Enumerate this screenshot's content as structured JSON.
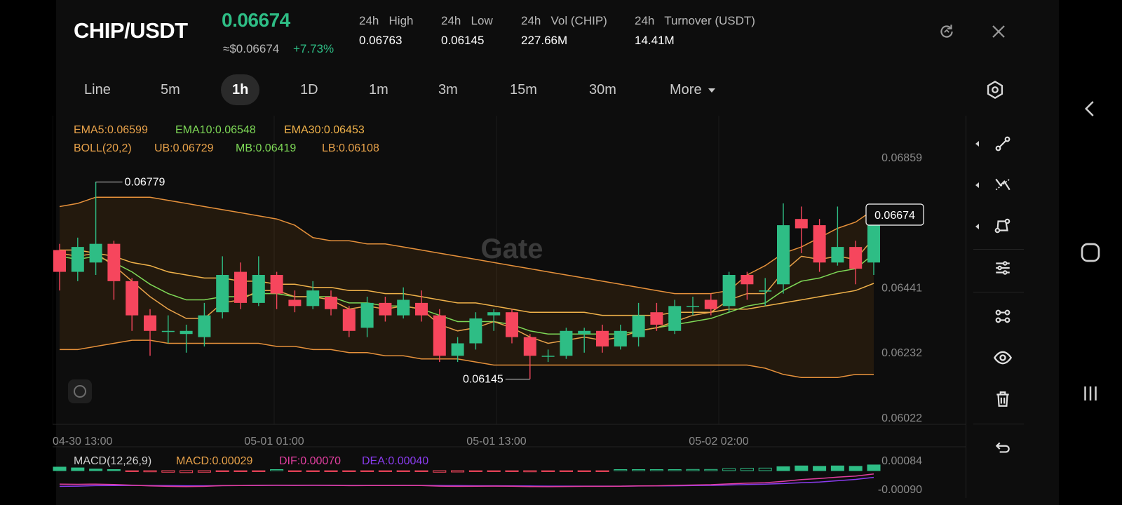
{
  "header": {
    "pair": "CHIP/USDT",
    "price": "0.06674",
    "usd_price": "≈$0.06674",
    "change": "+7.73%",
    "stats": [
      {
        "label": "24h   High",
        "value": "0.06763"
      },
      {
        "label": "24h   Low",
        "value": "0.06145"
      },
      {
        "label": "24h   Vol (CHIP)",
        "value": "227.66M"
      },
      {
        "label": "24h   Turnover (USDT)",
        "value": "14.41M"
      }
    ],
    "icons": [
      "refresh-icon",
      "close-icon"
    ]
  },
  "tabs": [
    {
      "label": "Line"
    },
    {
      "label": "5m"
    },
    {
      "label": "1h",
      "active": true
    },
    {
      "label": "1D"
    },
    {
      "label": "1m"
    },
    {
      "label": "3m"
    },
    {
      "label": "15m"
    },
    {
      "label": "30m"
    },
    {
      "label": "More"
    }
  ],
  "indicators": {
    "ema5": "EMA5:0.06599",
    "ema10": "EMA10:0.06548",
    "ema30": "EMA30:0.06453",
    "boll": "BOLL(20,2)",
    "ub": "UB:0.06729",
    "mb": "MB:0.06419",
    "lb": "LB:0.06108"
  },
  "chart_data": {
    "type": "candlestick",
    "y_axis_ticks": [
      "0.06859",
      "0.06441",
      "0.06232",
      "0.06022"
    ],
    "x_axis_ticks": [
      "04-30 13:00",
      "05-01 01:00",
      "05-01 13:00",
      "05-02 02:00"
    ],
    "high_marker": "0.06779",
    "low_marker": "0.06145",
    "last_price_label": "0.06674",
    "watermark": "Gate",
    "candles": [
      {
        "o": 0.0656,
        "c": 0.0649,
        "h": 0.0658,
        "l": 0.0643
      },
      {
        "o": 0.0649,
        "c": 0.0657,
        "h": 0.066,
        "l": 0.0646
      },
      {
        "o": 0.0652,
        "c": 0.0658,
        "h": 0.0678,
        "l": 0.0648
      },
      {
        "o": 0.0658,
        "c": 0.0646,
        "h": 0.0659,
        "l": 0.064
      },
      {
        "o": 0.0646,
        "c": 0.0635,
        "h": 0.0647,
        "l": 0.063
      },
      {
        "o": 0.0635,
        "c": 0.063,
        "h": 0.0637,
        "l": 0.0622
      },
      {
        "o": 0.063,
        "c": 0.063,
        "h": 0.0635,
        "l": 0.0626
      },
      {
        "o": 0.0629,
        "c": 0.063,
        "h": 0.0632,
        "l": 0.0623
      },
      {
        "o": 0.0628,
        "c": 0.0635,
        "h": 0.0639,
        "l": 0.0625
      },
      {
        "o": 0.0636,
        "c": 0.0648,
        "h": 0.0654,
        "l": 0.0634
      },
      {
        "o": 0.0649,
        "c": 0.0639,
        "h": 0.0652,
        "l": 0.0637
      },
      {
        "o": 0.0639,
        "c": 0.0648,
        "h": 0.0654,
        "l": 0.0638
      },
      {
        "o": 0.0648,
        "c": 0.0642,
        "h": 0.0649,
        "l": 0.0637
      },
      {
        "o": 0.064,
        "c": 0.0638,
        "h": 0.0643,
        "l": 0.0636
      },
      {
        "o": 0.0638,
        "c": 0.0643,
        "h": 0.0646,
        "l": 0.0637
      },
      {
        "o": 0.0641,
        "c": 0.0637,
        "h": 0.0643,
        "l": 0.0635
      },
      {
        "o": 0.0637,
        "c": 0.063,
        "h": 0.0638,
        "l": 0.0628
      },
      {
        "o": 0.0631,
        "c": 0.0639,
        "h": 0.0641,
        "l": 0.0628
      },
      {
        "o": 0.0639,
        "c": 0.0635,
        "h": 0.0641,
        "l": 0.0633
      },
      {
        "o": 0.0635,
        "c": 0.064,
        "h": 0.0644,
        "l": 0.0634
      },
      {
        "o": 0.0639,
        "c": 0.0635,
        "h": 0.0643,
        "l": 0.0633
      },
      {
        "o": 0.0635,
        "c": 0.0622,
        "h": 0.0637,
        "l": 0.062
      },
      {
        "o": 0.0622,
        "c": 0.0626,
        "h": 0.0628,
        "l": 0.062
      },
      {
        "o": 0.0626,
        "c": 0.0634,
        "h": 0.0636,
        "l": 0.0624
      },
      {
        "o": 0.0635,
        "c": 0.0636,
        "h": 0.0637,
        "l": 0.063
      },
      {
        "o": 0.0636,
        "c": 0.0628,
        "h": 0.0637,
        "l": 0.0626
      },
      {
        "o": 0.0628,
        "c": 0.0622,
        "h": 0.0629,
        "l": 0.06145
      },
      {
        "o": 0.0622,
        "c": 0.0622,
        "h": 0.0624,
        "l": 0.062
      },
      {
        "o": 0.0622,
        "c": 0.063,
        "h": 0.0631,
        "l": 0.0621
      },
      {
        "o": 0.0629,
        "c": 0.063,
        "h": 0.0631,
        "l": 0.0623
      },
      {
        "o": 0.063,
        "c": 0.0625,
        "h": 0.0632,
        "l": 0.0623
      },
      {
        "o": 0.0625,
        "c": 0.063,
        "h": 0.0632,
        "l": 0.0624
      },
      {
        "o": 0.0628,
        "c": 0.0635,
        "h": 0.0639,
        "l": 0.0625
      },
      {
        "o": 0.0636,
        "c": 0.0632,
        "h": 0.0639,
        "l": 0.063
      },
      {
        "o": 0.063,
        "c": 0.0638,
        "h": 0.064,
        "l": 0.0629
      },
      {
        "o": 0.0638,
        "c": 0.0638,
        "h": 0.0641,
        "l": 0.0635
      },
      {
        "o": 0.064,
        "c": 0.0637,
        "h": 0.0642,
        "l": 0.0635
      },
      {
        "o": 0.0638,
        "c": 0.0648,
        "h": 0.0649,
        "l": 0.0636
      },
      {
        "o": 0.0648,
        "c": 0.0645,
        "h": 0.0649,
        "l": 0.064
      },
      {
        "o": 0.0643,
        "c": 0.0643,
        "h": 0.0647,
        "l": 0.0638
      },
      {
        "o": 0.0645,
        "c": 0.0664,
        "h": 0.0671,
        "l": 0.0642
      },
      {
        "o": 0.0666,
        "c": 0.0663,
        "h": 0.067,
        "l": 0.0655
      },
      {
        "o": 0.0664,
        "c": 0.0652,
        "h": 0.0666,
        "l": 0.0649
      },
      {
        "o": 0.0652,
        "c": 0.0657,
        "h": 0.067,
        "l": 0.0651
      },
      {
        "o": 0.0657,
        "c": 0.065,
        "h": 0.0659,
        "l": 0.0645
      },
      {
        "o": 0.0652,
        "c": 0.06674,
        "h": 0.06674,
        "l": 0.0648
      }
    ],
    "boll_upper": [
      0.067,
      0.0671,
      0.0673,
      0.0673,
      0.0673,
      0.0673,
      0.0672,
      0.0671,
      0.067,
      0.0669,
      0.0668,
      0.0667,
      0.0666,
      0.0664,
      0.066,
      0.0659,
      0.0659,
      0.0658,
      0.0658,
      0.0657,
      0.0656,
      0.0655,
      0.0654,
      0.0653,
      0.0652,
      0.0651,
      0.065,
      0.0649,
      0.0648,
      0.0647,
      0.0646,
      0.0645,
      0.0644,
      0.0643,
      0.0642,
      0.0642,
      0.0642,
      0.0643,
      0.0648,
      0.0651,
      0.0655,
      0.0657,
      0.066,
      0.0663,
      0.0665,
      0.0669
    ],
    "boll_lower": [
      0.0624,
      0.0624,
      0.0625,
      0.0626,
      0.0627,
      0.0627,
      0.0626,
      0.0626,
      0.0626,
      0.0626,
      0.0626,
      0.0626,
      0.0625,
      0.0625,
      0.0624,
      0.0624,
      0.0623,
      0.0623,
      0.0622,
      0.0622,
      0.0621,
      0.0621,
      0.0621,
      0.062,
      0.0619,
      0.0619,
      0.0619,
      0.0619,
      0.0619,
      0.0619,
      0.0619,
      0.0619,
      0.0619,
      0.0619,
      0.0619,
      0.0619,
      0.0619,
      0.0619,
      0.0619,
      0.0618,
      0.0616,
      0.0615,
      0.0615,
      0.0615,
      0.0616,
      0.0616
    ],
    "ema30": [
      0.0656,
      0.0656,
      0.0655,
      0.0654,
      0.0652,
      0.0651,
      0.0649,
      0.0648,
      0.0647,
      0.0647,
      0.0646,
      0.0646,
      0.0645,
      0.0645,
      0.0644,
      0.0644,
      0.0643,
      0.0643,
      0.0642,
      0.0642,
      0.0641,
      0.064,
      0.0639,
      0.0639,
      0.0638,
      0.0637,
      0.0636,
      0.0636,
      0.0636,
      0.0636,
      0.0635,
      0.0635,
      0.0635,
      0.0635,
      0.0636,
      0.0636,
      0.0636,
      0.0637,
      0.0637,
      0.0638,
      0.0639,
      0.064,
      0.0641,
      0.0642,
      0.0643,
      0.06453
    ],
    "ema10": [
      0.0654,
      0.0653,
      0.0654,
      0.0652,
      0.0649,
      0.0645,
      0.0642,
      0.064,
      0.064,
      0.0641,
      0.0641,
      0.0642,
      0.0642,
      0.0641,
      0.0641,
      0.0641,
      0.0639,
      0.0639,
      0.0638,
      0.0638,
      0.0637,
      0.0635,
      0.0633,
      0.0633,
      0.0633,
      0.0632,
      0.063,
      0.0629,
      0.0629,
      0.0629,
      0.0629,
      0.0629,
      0.063,
      0.0631,
      0.0632,
      0.0633,
      0.0634,
      0.0636,
      0.0638,
      0.0639,
      0.0643,
      0.0646,
      0.0647,
      0.0649,
      0.065,
      0.06548
    ],
    "ema5": [
      0.0655,
      0.0654,
      0.0655,
      0.0651,
      0.0646,
      0.0641,
      0.0637,
      0.0634,
      0.0634,
      0.0639,
      0.064,
      0.0643,
      0.0643,
      0.0641,
      0.0641,
      0.064,
      0.0637,
      0.0638,
      0.0637,
      0.0638,
      0.0637,
      0.0632,
      0.063,
      0.0631,
      0.0633,
      0.0631,
      0.0628,
      0.0626,
      0.0627,
      0.0628,
      0.0627,
      0.0628,
      0.063,
      0.0631,
      0.0633,
      0.0635,
      0.0636,
      0.064,
      0.0642,
      0.0642,
      0.0649,
      0.0654,
      0.0653,
      0.0654,
      0.0653,
      0.06599
    ]
  },
  "macd": {
    "label": "MACD(12,26,9)",
    "macd": "MACD:0.00029",
    "dif": "DIF:0.00070",
    "dea": "DEA:0.00040",
    "ticks": [
      "0.00084",
      "-0.00090"
    ],
    "histogram": [
      0.00018,
      0.00014,
      8e-05,
      4e-05,
      -2e-05,
      -6e-05,
      -8e-05,
      -0.0001,
      -8e-05,
      -3e-05,
      -4e-05,
      -1e-05,
      0.0,
      -2e-05,
      -1e-05,
      -2e-05,
      -5e-05,
      -3e-05,
      -4e-05,
      -2e-05,
      -3e-05,
      -8e-05,
      -7e-05,
      -3e-05,
      -1e-05,
      -4e-05,
      -6e-05,
      -5e-05,
      -2e-05,
      -1e-05,
      -2e-05,
      0.0,
      3e-05,
      2e-05,
      5e-05,
      6e-05,
      6e-05,
      0.0001,
      0.00012,
      0.00013,
      0.0002,
      0.00024,
      0.00022,
      0.00024,
      0.00022,
      0.00029
    ],
    "dif_series": [
      -0.0002,
      -0.00022,
      -0.0002,
      -0.00024,
      -0.0003,
      -0.00036,
      -0.0004,
      -0.00042,
      -0.0004,
      -0.00034,
      -0.00033,
      -0.00031,
      -0.0003,
      -0.00031,
      -0.0003,
      -0.00031,
      -0.00034,
      -0.00033,
      -0.00033,
      -0.00032,
      -0.00033,
      -0.00038,
      -0.0004,
      -0.00039,
      -0.00038,
      -0.00039,
      -0.00042,
      -0.00043,
      -0.00041,
      -0.0004,
      -0.0004,
      -0.00039,
      -0.00036,
      -0.00035,
      -0.00031,
      -0.00028,
      -0.00025,
      -0.00018,
      -0.00012,
      -8e-05,
      5e-05,
      0.0002,
      0.0003,
      0.00042,
      0.00052,
      0.0007
    ],
    "dea_series": [
      -0.0004,
      -0.00038,
      -0.00034,
      -0.00033,
      -0.00032,
      -0.00033,
      -0.00034,
      -0.00035,
      -0.00035,
      -0.00034,
      -0.00033,
      -0.00032,
      -0.00031,
      -0.00031,
      -0.00031,
      -0.00031,
      -0.00032,
      -0.00032,
      -0.00032,
      -0.00032,
      -0.00032,
      -0.00033,
      -0.00034,
      -0.00035,
      -0.00035,
      -0.00036,
      -0.00037,
      -0.00038,
      -0.00038,
      -0.00038,
      -0.00038,
      -0.00038,
      -0.00037,
      -0.00036,
      -0.00035,
      -0.00033,
      -0.00031,
      -0.00028,
      -0.00024,
      -0.0002,
      -0.00015,
      -8e-05,
      -1e-05,
      0.0001,
      0.00022,
      0.0004
    ]
  },
  "toolbar_icons": [
    "drawing-line-icon",
    "trend-tool-icon",
    "shape-tool-icon",
    "indicator-settings-icon",
    "compare-icon",
    "visibility-icon",
    "delete-icon",
    "undo-icon"
  ],
  "colors": {
    "up": "#2ebd85",
    "down": "#f6465d",
    "ema5": "#e8a24a",
    "ema10": "#7ed957",
    "ema30": "#f0b24a",
    "boll": "#e6913b",
    "dif": "#e23fa0",
    "dea": "#8a3cf0",
    "panel_bg": "#0d0d0d"
  }
}
